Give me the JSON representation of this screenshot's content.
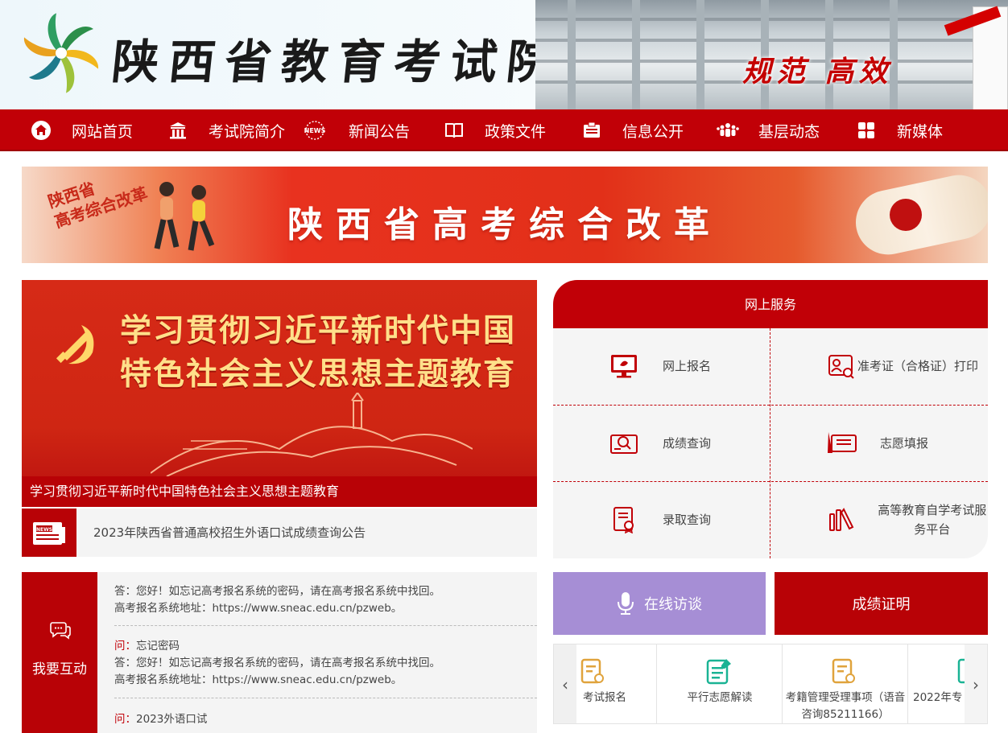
{
  "header": {
    "site_title": "陕西省教育考试院",
    "slogan": "规范 高效"
  },
  "nav": {
    "items": [
      {
        "label": "网站首页",
        "icon": "home-icon"
      },
      {
        "label": "考试院简介",
        "icon": "institution-icon"
      },
      {
        "label": "新闻公告",
        "icon": "news-icon"
      },
      {
        "label": "政策文件",
        "icon": "book-icon"
      },
      {
        "label": "信息公开",
        "icon": "id-card-icon"
      },
      {
        "label": "基层动态",
        "icon": "people-icon"
      },
      {
        "label": "新媒体",
        "icon": "grid-icon"
      }
    ],
    "news_icon_text": "NEWS"
  },
  "banner": {
    "title": "陕西省高考综合改革",
    "badge_line1": "陕西省",
    "badge_line2": "高考综合改革"
  },
  "featured": {
    "title_line1": "学习贯彻习近平新时代中国",
    "title_line2": "特色社会主义思想主题教育",
    "caption": "学习贯彻习近平新时代中国特色社会主义思想主题教育"
  },
  "news": {
    "icon_text": "NEWS",
    "headline": "2023年陕西省普通高校招生外语口试成绩查询公告"
  },
  "services": {
    "heading": "网上服务",
    "items": [
      {
        "label": "网上报名",
        "icon": "monitor-icon"
      },
      {
        "label": "准考证（合格证）打印",
        "icon": "admission-ticket-icon"
      },
      {
        "label": "成绩查询",
        "icon": "score-search-icon"
      },
      {
        "label": "志愿填报",
        "icon": "pen-form-icon"
      },
      {
        "label": "录取查询",
        "icon": "admission-doc-icon"
      },
      {
        "label": "高等教育自学考试服务平台",
        "icon": "self-study-icon"
      }
    ]
  },
  "interact": {
    "title": "我要互动",
    "qa_top_answer": "答：您好！如忘记高考报名系统的密码，请在高考报名系统中找回。",
    "qa_top_address": "高考报名系统地址：https://www.sneac.edu.cn/pzweb。",
    "q_prefix": "问：",
    "a_prefix": "答：",
    "qa2_question": "忘记密码",
    "qa2_answer": "您好！如忘记高考报名系统的密码，请在高考报名系统中找回。",
    "qa2_address": "高考报名系统地址：https://www.sneac.edu.cn/pzweb。",
    "qa3_question": "2023外语口试"
  },
  "quick": {
    "online_talk": "在线访谈",
    "score_cert": "成绩证明"
  },
  "carousel": {
    "items": [
      {
        "label": "考试报名",
        "icon": "form-icon",
        "color": "#e0a33c"
      },
      {
        "label": "平行志愿解读",
        "icon": "edit-doc-icon",
        "color": "#1ab394"
      },
      {
        "label": "考籍管理受理事项（语音",
        "label2": "咨询85211166）",
        "icon": "form-user-icon",
        "color": "#e0a33c"
      },
      {
        "label": "2022年专",
        "icon": "doc-icon",
        "color": "#1ab394"
      }
    ]
  },
  "colors": {
    "primary_red": "#c10007",
    "dark_red": "#b80206",
    "purple": "#a68ed5"
  }
}
